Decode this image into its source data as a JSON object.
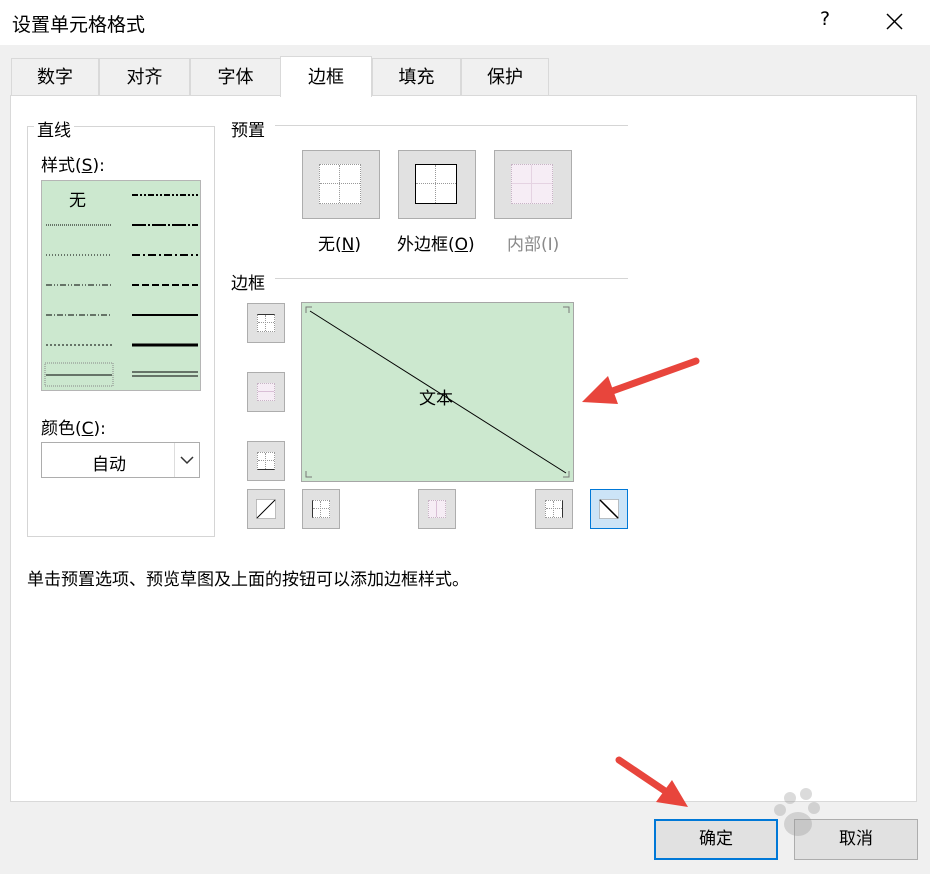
{
  "window": {
    "title": "设置单元格格式",
    "help_label": "?"
  },
  "tabs": [
    {
      "label": "数字"
    },
    {
      "label": "对齐"
    },
    {
      "label": "字体"
    },
    {
      "label": "边框",
      "active": true
    },
    {
      "label": "填充"
    },
    {
      "label": "保护"
    }
  ],
  "line_group": {
    "title": "直线",
    "style_label_prefix": "样式(",
    "style_label_key": "S",
    "style_label_suffix": "):",
    "none_label": "无",
    "color_label_prefix": "颜色(",
    "color_label_key": "C",
    "color_label_suffix": "):",
    "color_value": "自动"
  },
  "presets": {
    "title": "预置",
    "items": [
      {
        "label_prefix": "无(",
        "key": "N",
        "label_suffix": ")",
        "icon": "border-none-icon",
        "enabled": true
      },
      {
        "label_prefix": "外边框(",
        "key": "O",
        "label_suffix": ")",
        "icon": "border-outline-icon",
        "enabled": true
      },
      {
        "label_prefix": "内部(",
        "key": "I",
        "label_suffix": ")",
        "icon": "border-inside-icon",
        "enabled": false
      }
    ]
  },
  "border": {
    "title": "边框",
    "preview_text": "文本",
    "diagonal_down_active": true
  },
  "hint": "单击预置选项、预览草图及上面的按钮可以添加边框样式。",
  "footer": {
    "ok_label": "确定",
    "cancel_label": "取消"
  },
  "colors": {
    "preview_bg": "#cce8cf",
    "accent": "#0078d7",
    "arrow": "#e8453c"
  }
}
